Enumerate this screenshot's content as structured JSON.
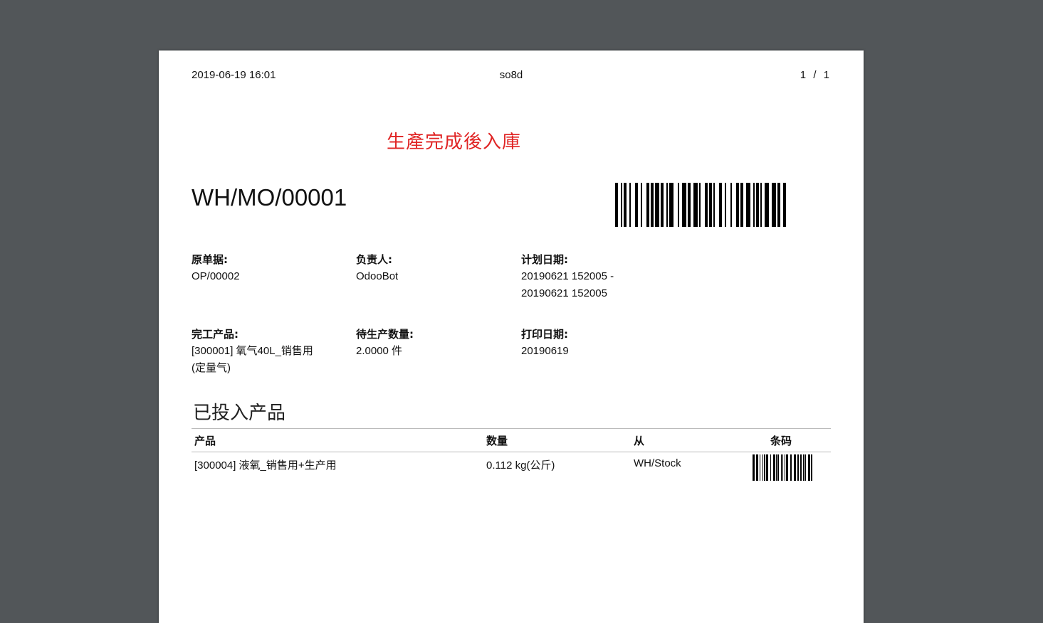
{
  "header": {
    "datetime": "2019-06-19 16:01",
    "company": "so8d",
    "page_current": "1",
    "page_sep": "/",
    "page_total": "1"
  },
  "stamp_text": "生產完成後入庫",
  "document": {
    "name": "WH/MO/00001",
    "barcode_value": "WH/MO/00001"
  },
  "info": {
    "origin_label": "原单据:",
    "origin_value": "OP/00002",
    "responsible_label": "负责人:",
    "responsible_value": "OdooBot",
    "planned_label": "计划日期:",
    "planned_line1": "20190621 152005 -",
    "planned_line2": "20190621 152005",
    "product_label": "完工产品:",
    "product_line1": "[300001] 氧气40L_销售用",
    "product_line2": "(定量气)",
    "qty_label": "待生产数量:",
    "qty_value": "2.0000 件",
    "print_label": "打印日期:",
    "print_value": "20190619"
  },
  "consumed": {
    "title": "已投入产品",
    "columns": [
      "产品",
      "数量",
      "从",
      "条码"
    ],
    "rows": [
      {
        "product": "[300004] 液氧_销售用+生产用",
        "quantity": "0.112 kg(公斤)",
        "from": "WH/Stock"
      }
    ]
  }
}
